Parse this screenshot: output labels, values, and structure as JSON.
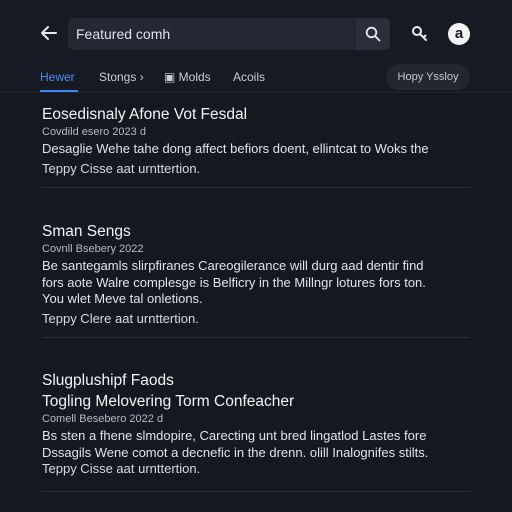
{
  "header": {
    "search_value": "Featured comh",
    "avatar_letter": "a",
    "icons": [
      "back-arrow-icon",
      "search-icon",
      "key-icon"
    ]
  },
  "tabs": [
    {
      "label": "Hewer",
      "active": true
    },
    {
      "label": "Stongs ›",
      "active": false
    },
    {
      "label": "▣ Molds",
      "active": false
    },
    {
      "label": "Acoils",
      "active": false
    }
  ],
  "view_chip": "Hopy Yssloy",
  "posts": [
    {
      "title": "Eosedisnaly Afone Vot Fesdal",
      "date": "Covdild esero 2023   d",
      "lines": [
        "Desaglie Wehe tahe dong affect befiors doent, ellintcat to Woks the"
      ],
      "footer": "Teppy Cisse aat urnttertion."
    },
    {
      "title": "Sman Sengs",
      "date": "Covnll Bsebery 2022",
      "lines": [
        "Be santegamls slirpfiranes Careogilerance will durg aad dentir find",
        "fors aote Walre complesge is Belficry in the Millngr lotures fors ton.",
        "You wlet Meve tal onletions."
      ],
      "footer": "Teppy Clere aat urnttertion."
    },
    {
      "title": "Slugplushipf Faods",
      "subtitle": "Togling Melovering Torm Confeacher",
      "date": "Comell Besebero 2022   d",
      "lines": [
        "Bs sten a fhene slmdopire, Carecting unt bred lingatlod Lastes fore",
        "Dssagils Wene comot a decnefic in the drenn. olill Inalognifes stilts."
      ],
      "footer": "Teppy Cisse aat urnttertion."
    }
  ],
  "colors": {
    "background": "#141821",
    "accent": "#3e84f2",
    "divider": "#2a2f39"
  }
}
